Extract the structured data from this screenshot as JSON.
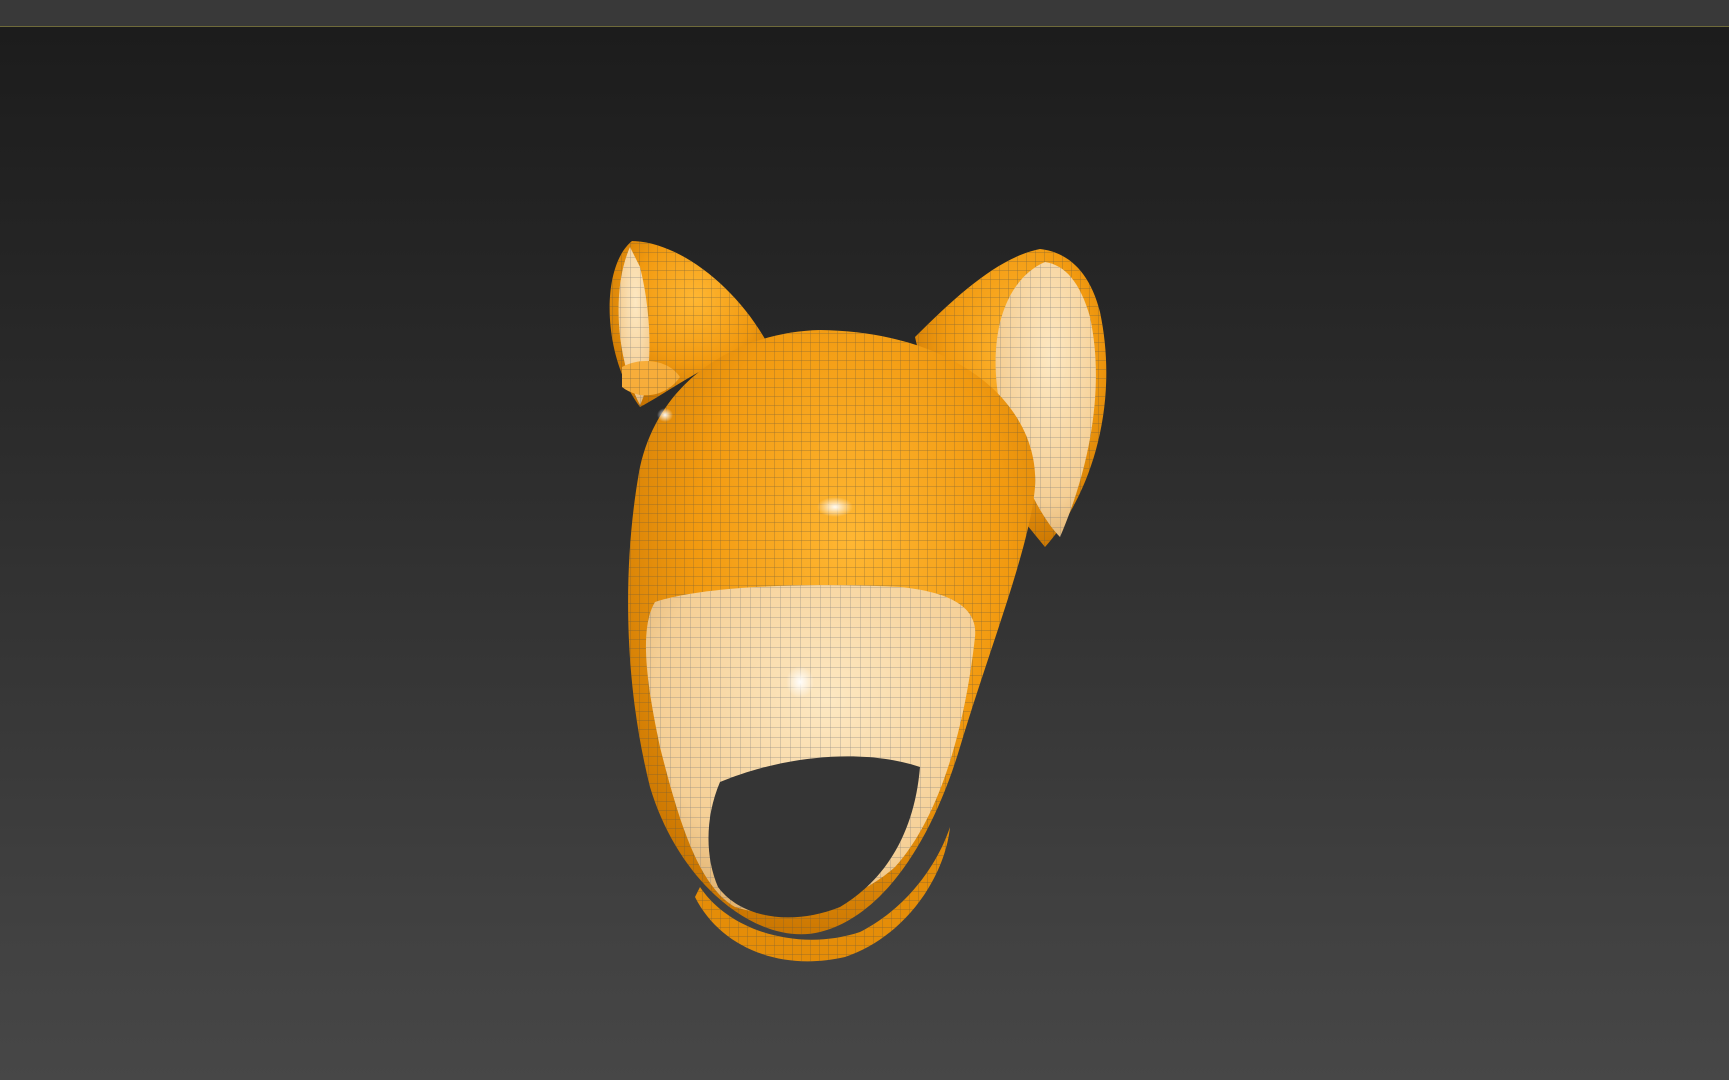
{
  "window": {
    "title": ""
  },
  "viewport": {
    "background_top": "#1c1c1c",
    "background_bottom": "#474747"
  },
  "model": {
    "name": "",
    "outer_color": "#f29a10",
    "inner_color": "#f7d6a0",
    "wire_color": "#5a5a5a",
    "icon": "hood-with-ears-mesh"
  }
}
